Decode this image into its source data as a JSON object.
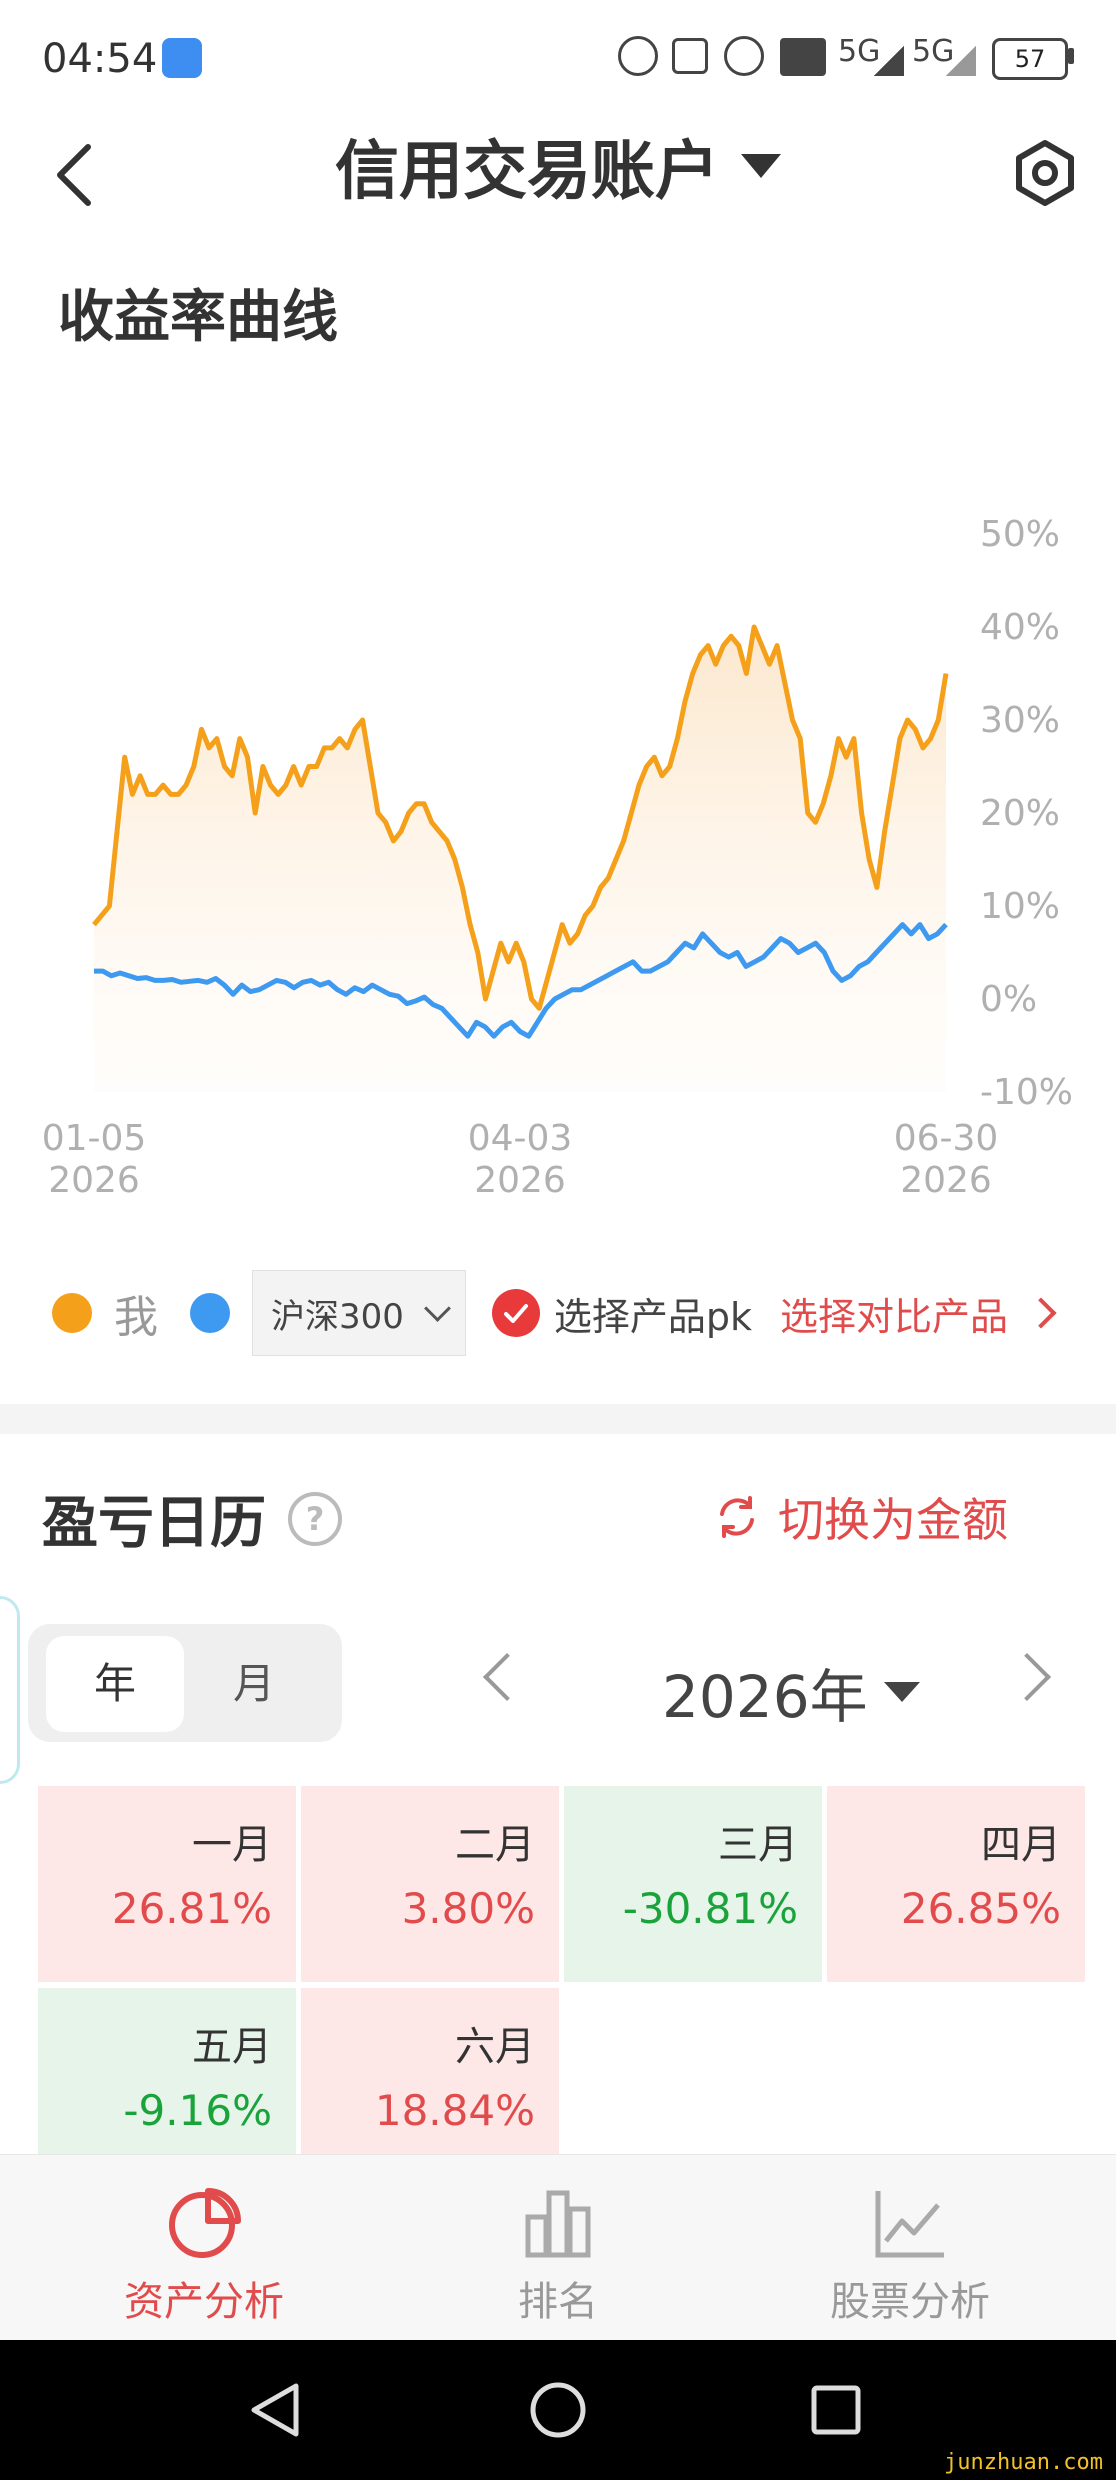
{
  "status_bar": {
    "time": "04:54",
    "network_a": "5G",
    "network_b": "5G",
    "battery": "57"
  },
  "header": {
    "title": "信用交易账户"
  },
  "chart_section": {
    "title": "收益率曲线"
  },
  "chart_data": {
    "type": "area",
    "x_ticks": [
      {
        "date": "01-05",
        "year": "2026"
      },
      {
        "date": "04-03",
        "year": "2026"
      },
      {
        "date": "06-30",
        "year": "2026"
      }
    ],
    "y_ticks": [
      "50%",
      "40%",
      "30%",
      "20%",
      "10%",
      "0%",
      "-10%"
    ],
    "ylim": [
      -10,
      50
    ],
    "x_range": [
      "2026-01-05",
      "2026-06-30"
    ],
    "grid": false,
    "series": [
      {
        "name": "我",
        "color": "#f5a01a",
        "filled": true,
        "values": [
          8,
          9,
          10,
          18,
          26,
          22,
          24,
          22,
          22,
          23,
          22,
          22,
          23,
          25,
          29,
          27,
          28,
          25,
          24,
          28,
          26,
          20,
          25,
          23,
          22,
          23,
          25,
          23,
          25,
          25,
          27,
          27,
          28,
          27,
          29,
          30,
          25,
          20,
          19,
          17,
          18,
          20,
          21,
          21,
          19,
          18,
          17,
          15,
          12,
          8,
          5,
          0,
          3,
          6,
          4,
          6,
          4,
          0,
          -1,
          2,
          5,
          8,
          6,
          7,
          9,
          10,
          12,
          13,
          15,
          17,
          20,
          23,
          25,
          26,
          24,
          25,
          28,
          32,
          35,
          37,
          38,
          36,
          38,
          39,
          38,
          35,
          40,
          38,
          36,
          38,
          34,
          30,
          28,
          20,
          19,
          21,
          24,
          28,
          26,
          28,
          20,
          15,
          12,
          18,
          23,
          28,
          30,
          29,
          27,
          28,
          30,
          35
        ]
      },
      {
        "name": "沪深300",
        "color": "#3d9af0",
        "filled": false,
        "values": [
          3,
          3,
          2.5,
          2.8,
          2.5,
          2.2,
          2.3,
          2,
          2,
          2.1,
          1.8,
          1.9,
          2,
          1.8,
          2.2,
          1.5,
          0.5,
          1.5,
          0.8,
          1,
          1.5,
          2,
          1.8,
          1.2,
          1.8,
          2,
          1.5,
          1.8,
          1,
          0.5,
          1.2,
          0.8,
          1.5,
          1,
          0.5,
          0.3,
          -0.5,
          -0.2,
          0.2,
          -0.6,
          -1,
          -2,
          -3,
          -4,
          -2.5,
          -3,
          -4,
          -3,
          -2.5,
          -3.5,
          -4,
          -2.5,
          -1,
          0,
          0.5,
          1,
          1,
          1.5,
          2,
          2.5,
          3,
          3.5,
          4,
          3,
          3,
          3.5,
          4,
          5,
          6,
          5.5,
          7,
          6,
          5,
          4.5,
          5,
          3.5,
          4,
          4.5,
          5.5,
          6.5,
          6,
          5,
          5.5,
          6,
          5,
          3,
          2,
          2.5,
          3.5,
          4,
          5,
          6,
          7,
          8,
          7,
          8,
          6.5,
          7,
          8
        ]
      }
    ]
  },
  "legend": {
    "me": "我",
    "benchmark": "沪深300",
    "pk_label": "选择产品pk",
    "compare_label": "选择对比产品"
  },
  "calendar": {
    "title": "盈亏日历",
    "switch_label": "切换为金额",
    "tab_year": "年",
    "tab_month": "月",
    "year_label": "2026年",
    "months": [
      {
        "name": "一月",
        "value": "26.81%",
        "sign": "pos"
      },
      {
        "name": "二月",
        "value": "3.80%",
        "sign": "pos"
      },
      {
        "name": "三月",
        "value": "-30.81%",
        "sign": "neg"
      },
      {
        "name": "四月",
        "value": "26.85%",
        "sign": "pos"
      },
      {
        "name": "五月",
        "value": "-9.16%",
        "sign": "neg"
      },
      {
        "name": "六月",
        "value": "18.84%",
        "sign": "pos"
      }
    ]
  },
  "bottom_nav": {
    "items": [
      "资产分析",
      "排名",
      "股票分析"
    ],
    "active": "资产分析"
  },
  "watermark": "junzhuan.com",
  "colors": {
    "accent_red": "#e14b4b",
    "positive_bg": "#fde7e7",
    "negative_bg": "#e6f4ea",
    "series_me": "#f5a01a",
    "series_bench": "#3d9af0"
  }
}
